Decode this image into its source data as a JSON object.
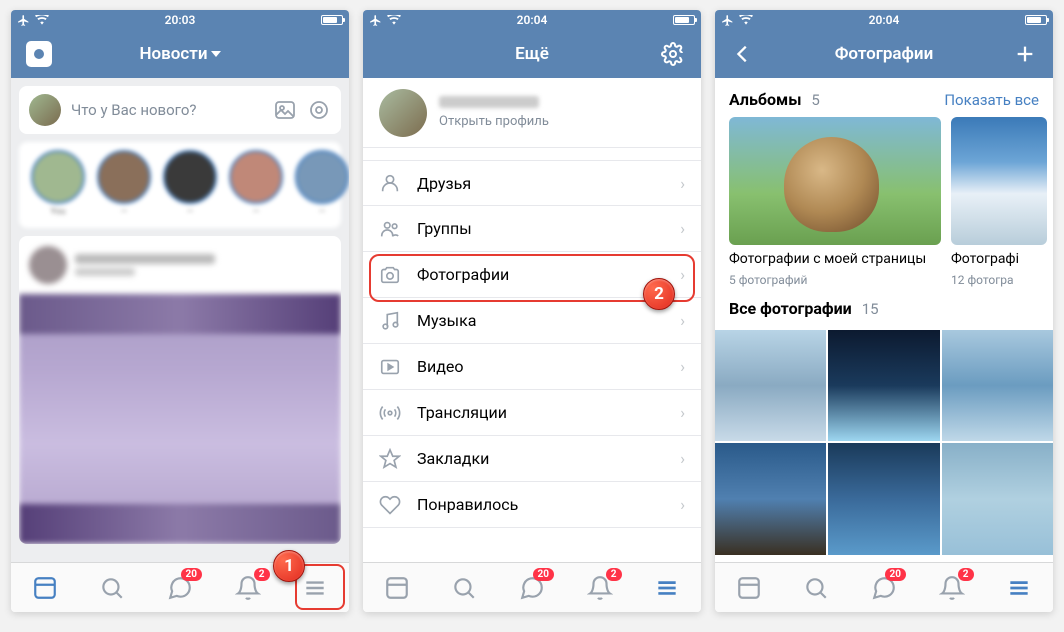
{
  "status": {
    "times": [
      "20:03",
      "20:04",
      "20:04"
    ]
  },
  "screen1": {
    "title": "Новости",
    "compose_placeholder": "Что у Вас нового?"
  },
  "screen2": {
    "title": "Ещё",
    "open_profile": "Открыть профиль",
    "menu": [
      {
        "icon": "friends",
        "label": "Друзья"
      },
      {
        "icon": "groups",
        "label": "Группы"
      },
      {
        "icon": "photos",
        "label": "Фотографии"
      },
      {
        "icon": "music",
        "label": "Музыка"
      },
      {
        "icon": "video",
        "label": "Видео"
      },
      {
        "icon": "live",
        "label": "Трансляции"
      },
      {
        "icon": "bookmarks",
        "label": "Закладки"
      },
      {
        "icon": "liked",
        "label": "Понравилось"
      }
    ]
  },
  "screen3": {
    "title": "Фотографии",
    "albums_label": "Альбомы",
    "albums_count": "5",
    "show_all": "Показать все",
    "album1_title": "Фотографии с моей страницы",
    "album1_sub": "5 фотографий",
    "album2_title": "Фотографі",
    "album2_sub": "12 фотогра",
    "all_photos_label": "Все фотографии",
    "all_photos_count": "15"
  },
  "tabbar": {
    "badge_messages": "20",
    "badge_notif": "2"
  },
  "callouts": {
    "one": "1",
    "two": "2"
  }
}
